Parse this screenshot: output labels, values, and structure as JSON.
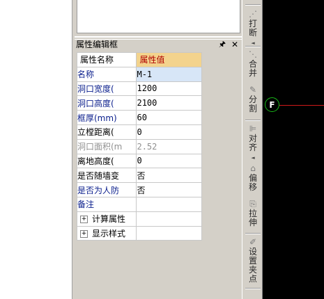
{
  "panel": {
    "title": "属性编辑框",
    "pin_icon": "pin-icon",
    "close_icon": "close-icon"
  },
  "grid": {
    "headers": {
      "name": "属性名称",
      "value": "属性值"
    },
    "rows": [
      {
        "name": "名称",
        "value": "M-1"
      },
      {
        "name": "洞口宽度(",
        "value": "1200"
      },
      {
        "name": "洞口高度(",
        "value": "2100"
      },
      {
        "name": "框厚(mm)",
        "value": "60"
      },
      {
        "name": "立樘距离(",
        "value": "0"
      },
      {
        "name": "洞口面积(m",
        "value": "2.52"
      },
      {
        "name": "离地高度(",
        "value": "0"
      },
      {
        "name": "是否随墙变",
        "value": "否"
      },
      {
        "name": "是否为人防",
        "value": "否"
      },
      {
        "name": "备注",
        "value": ""
      }
    ],
    "groups": [
      {
        "expander": "+",
        "label": "计算属性"
      },
      {
        "expander": "+",
        "label": "显示样式"
      }
    ]
  },
  "toolbar": {
    "items": [
      {
        "icon": "break-icon",
        "label": "打断",
        "arrow": "◄"
      },
      {
        "icon": "merge-icon",
        "label": "合并"
      },
      {
        "icon": "split-icon",
        "label": "分割"
      },
      {
        "icon": "align-icon",
        "label": "对齐",
        "arrow": "◄"
      },
      {
        "icon": "offset-icon",
        "label": "偏移"
      },
      {
        "icon": "stretch-icon",
        "label": "拉伸"
      },
      {
        "icon": "set-grip-icon",
        "label": "设置夹点"
      }
    ]
  },
  "canvas": {
    "marker_label": "F",
    "background": "#000000",
    "marker_color": "#19b919",
    "line_color": "#d11a1a"
  },
  "colors": {
    "header_value_bg": "#f3d38d",
    "header_value_text": "#b00000",
    "label_blue": "#0a1e8c",
    "label_gray": "#909090",
    "selected_bg": "#d7e6f7"
  }
}
